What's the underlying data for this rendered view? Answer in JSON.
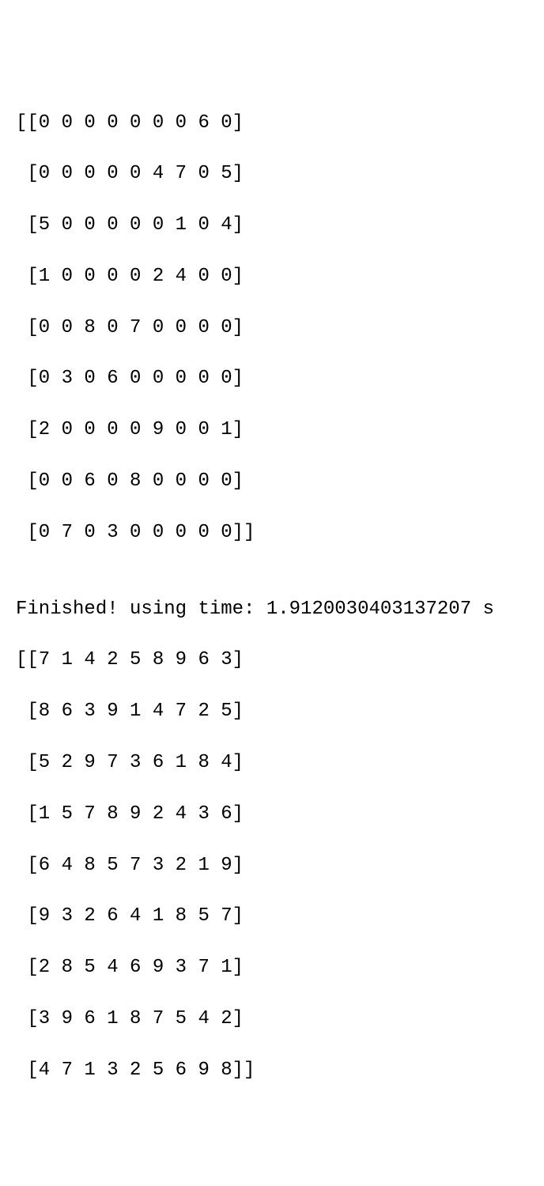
{
  "input_matrix": {
    "rows": [
      "[[0 0 0 0 0 0 0 6 0]",
      " [0 0 0 0 0 4 7 0 5]",
      " [5 0 0 0 0 0 1 0 4]",
      " [1 0 0 0 0 2 4 0 0]",
      " [0 0 8 0 7 0 0 0 0]",
      " [0 3 0 6 0 0 0 0 0]",
      " [2 0 0 0 0 9 0 0 1]",
      " [0 0 6 0 8 0 0 0 0]",
      " [0 7 0 3 0 0 0 0 0]]"
    ]
  },
  "status": {
    "text": "Finished! using time: 1.9120030403137207 s"
  },
  "output_matrix": {
    "rows": [
      "[[7 1 4 2 5 8 9 6 3]",
      " [8 6 3 9 1 4 7 2 5]",
      " [5 2 9 7 3 6 1 8 4]",
      " [1 5 7 8 9 2 4 3 6]",
      " [6 4 8 5 7 3 2 1 9]",
      " [9 3 2 6 4 1 8 5 7]",
      " [2 8 5 4 6 9 3 7 1]",
      " [3 9 6 1 8 7 5 4 2]",
      " [4 7 1 3 2 5 6 9 8]]"
    ]
  }
}
